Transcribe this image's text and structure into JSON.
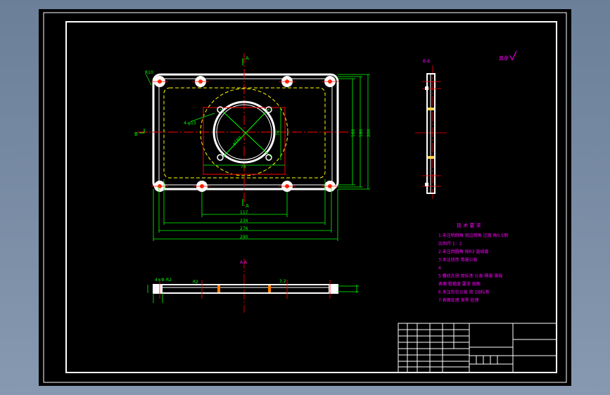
{
  "colors": {
    "outline": "#ffffff",
    "dimension": "#00ff00",
    "centerline": "#ff0000",
    "hidden": "#ffff00",
    "notes": "#ff00ff",
    "frame": "#ffffff",
    "hole_accent": "#ff8000"
  },
  "drawing": {
    "label_a_section": "A",
    "label_b_left": "B",
    "label_a_top": "A",
    "label_a_bottom": "A",
    "label_b_view": "B-B",
    "label_a_view": "A-A",
    "roughness_note": "其余",
    "dim_r10": "R10",
    "dim_phi_left": "4-φ13",
    "dim_phi_center": "φ180",
    "dim_inner_bottom": "117",
    "dim_234": "234",
    "dim_276": "276",
    "dim_290": "290",
    "dim_right_1": "160",
    "dim_right_2": "180",
    "dim_right_3": "200",
    "dim_v_center": "76",
    "dim_h_center": "76",
    "dim_side_a": "4×Φ",
    "dim_side_b": "R2",
    "dim_side_c": "R2",
    "dim_side_d": "3.2"
  },
  "notes": {
    "title": "技  术  要  求",
    "lines": [
      "1.未注明倒角 锐边倒角 过渡 角0.5倒",
      "  比例尺 1：2",
      "2.未注倒圆角 按R3  直线度",
      "3.未注线性 角度公差",
      "4.",
      "5.螺纹孔径 按标准 公差  精度  等级",
      "  表面 粗糙度 要求 按图",
      "6.未注形位公差 按 GB标准",
      "7.表面处理 发黑 处理"
    ]
  }
}
